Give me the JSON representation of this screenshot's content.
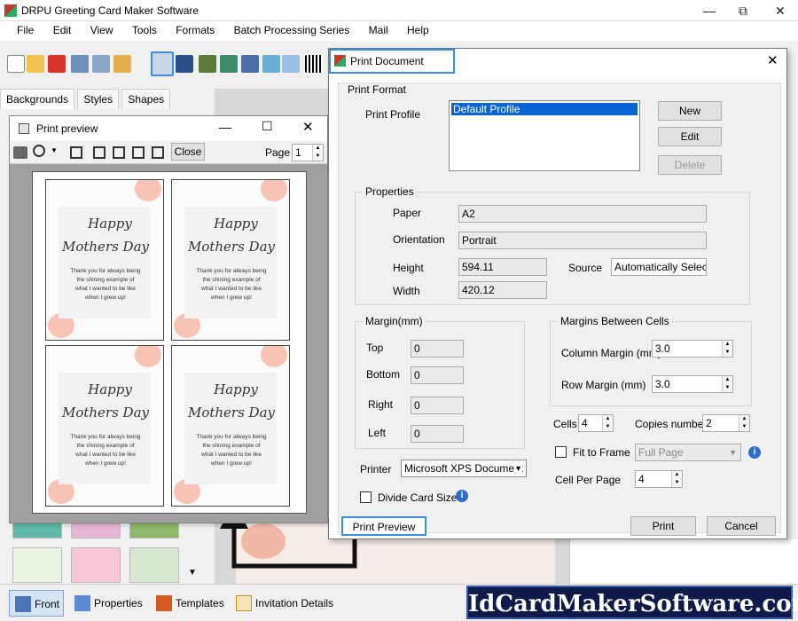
{
  "app": {
    "title": "DRPU Greeting Card Maker Software",
    "menu": [
      "File",
      "Edit",
      "View",
      "Tools",
      "Formats",
      "Batch Processing Series",
      "Mail",
      "Help"
    ],
    "tabs": [
      "Backgrounds",
      "Styles",
      "Shapes"
    ],
    "bottom": {
      "front": "Front",
      "properties": "Properties",
      "templates": "Templates",
      "invitation": "Invitation Details",
      "website": "IdCardMakerSoftware.com"
    }
  },
  "preview": {
    "title": "Print preview",
    "close_label": "Close",
    "page_label": "Page",
    "page_value": "1",
    "card": {
      "line1": "Happy",
      "line2": "Mothers Day",
      "message": [
        "Thank you for always being",
        "the shining example of",
        "what I wanted to be like",
        "when I grew up!"
      ]
    }
  },
  "dialog": {
    "title": "Print Document",
    "print_format": "Print Format",
    "print_profile_label": "Print Profile",
    "profiles": [
      "Default Profile"
    ],
    "new_btn": "New",
    "edit_btn": "Edit",
    "delete_btn": "Delete",
    "properties_label": "Properties",
    "paper_label": "Paper",
    "paper_value": "A2",
    "orientation_label": "Orientation",
    "orientation_value": "Portrait",
    "height_label": "Height",
    "height_value": "594.11",
    "width_label": "Width",
    "width_value": "420.12",
    "source_label": "Source",
    "source_value": "Automatically Select",
    "margin_label": "Margin(mm)",
    "top_label": "Top",
    "top_value": "0",
    "bottom_label": "Bottom",
    "bottom_value": "0",
    "right_label": "Right",
    "right_value": "0",
    "left_label": "Left",
    "left_value": "0",
    "cells_margin_label": "Margins Between Cells",
    "col_margin_label": "Column Margin (mm)",
    "col_margin_value": "3.0",
    "row_margin_label": "Row Margin (mm)",
    "row_margin_value": "3.0",
    "cells_label": "Cells",
    "cells_value": "4",
    "copies_label": "Copies number",
    "copies_value": "2",
    "fit_label": "Fit to Frame",
    "fit_select": "Full Page",
    "cpp_label": "Cell Per Page",
    "cpp_value": "4",
    "printer_label": "Printer",
    "printer_value": "Microsoft XPS Document",
    "divide_label": "Divide Card Size",
    "preview_btn": "Print Preview",
    "print_btn": "Print",
    "cancel_btn": "Cancel"
  },
  "colors": {
    "accent": "#3b8de0",
    "banner": "#0d1a4a",
    "selection": "#0a64d6"
  }
}
